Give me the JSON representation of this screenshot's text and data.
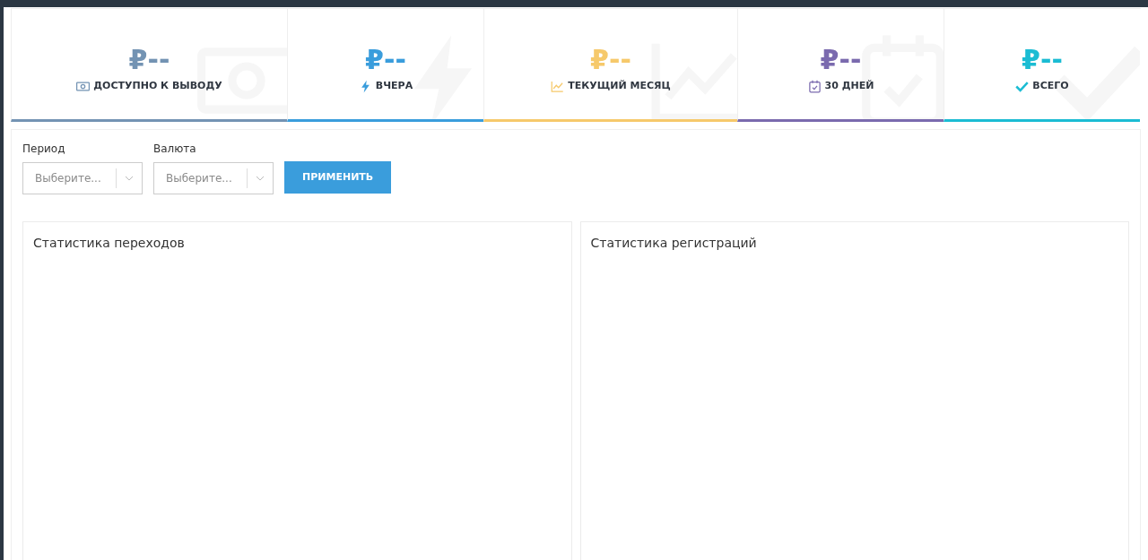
{
  "stats": [
    {
      "amount": "₽--",
      "label": "ДОСТУПНО К ВЫВОДУ",
      "kind": "money",
      "color": "#7393b3"
    },
    {
      "amount": "₽--",
      "label": "ВЧЕРА",
      "kind": "bolt",
      "color": "#3a9ddc"
    },
    {
      "amount": "₽--",
      "label": "ТЕКУЩИЙ МЕСЯЦ",
      "kind": "trend",
      "color": "#f6c96b"
    },
    {
      "amount": "₽--",
      "label": "30 ДНЕЙ",
      "kind": "calendar",
      "color": "#7a6aae"
    },
    {
      "amount": "₽--",
      "label": "ВСЕГО",
      "kind": "check",
      "color": "#1bbcd3"
    }
  ],
  "filters": [
    {
      "label": "Период",
      "placeholder": "Выберите..."
    },
    {
      "label": "Валюта",
      "placeholder": "Выберите..."
    }
  ],
  "apply_button": "ПРИМЕНИТЬ",
  "panels": [
    {
      "title": "Статистика переходов"
    },
    {
      "title": "Статистика регистраций"
    }
  ]
}
